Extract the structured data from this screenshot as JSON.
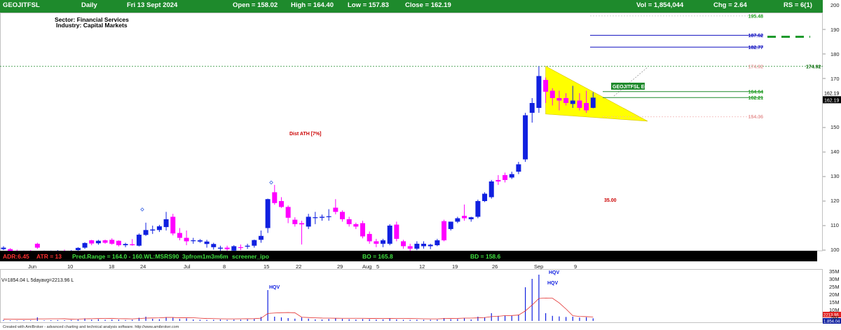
{
  "header": {
    "symbol": "GEOJITFSL",
    "interval": "Daily",
    "date": "Fri 13 Sept 2024",
    "open": "Open = 158.02",
    "high": "High = 164.40",
    "low": "Low = 157.83",
    "close": "Close = 162.19",
    "vol": "Vol = 1,854,044",
    "chg": "Chg = 2.64",
    "rs": "RS = 6(1)"
  },
  "sector": "Sector: Financial Services",
  "industry": "Industry: Capital Markets",
  "status_bar": {
    "adr": "ADR:6.45",
    "atr": "ATR = 13",
    "pred": "Pred.Range = 164.0 - 160.WL:MSRS90",
    "screens": "3pfrom1m3m6m",
    "screener": "screener_ipo",
    "bo": "BO = 165.8",
    "bd": "BD = 158.6"
  },
  "date_labels": [
    "Jun",
    "10",
    "18",
    "24",
    "Jul",
    "8",
    "15",
    "22",
    "29",
    "Aug",
    "5",
    "12",
    "19",
    "26",
    "Sep",
    "9"
  ],
  "volume_info": "V=1854.04 L 5dayavg=2213.96 L",
  "credit": "Created with AmiBroker - advanced charting and technical analysis software. http://www.amibroker.com",
  "colors": {
    "up": "#1020e0",
    "down": "#ff00ff",
    "triangle": "#ffff00",
    "header_bg": "#1e8a2c",
    "ma_line": "#e23030"
  },
  "chart_data": [
    {
      "type": "candlestick",
      "title": "GEOJITFSL",
      "y_ticks": [
        100,
        110,
        120,
        130,
        140,
        150,
        160,
        170,
        180,
        190,
        200
      ],
      "ylim": [
        97,
        204
      ],
      "grid": false,
      "candles": [
        {
          "o": 101.0,
          "h": 101.6,
          "l": 100.0,
          "c": 100.4,
          "d": "up"
        },
        {
          "o": 100.4,
          "h": 100.8,
          "l": 99.2,
          "c": 99.6,
          "d": "down"
        },
        {
          "o": 99.6,
          "h": 100.2,
          "l": 98.8,
          "c": 99.0,
          "d": "down"
        },
        {
          "o": 99.0,
          "h": 99.8,
          "l": 98.5,
          "c": 99.4,
          "d": "up"
        },
        {
          "o": 99.4,
          "h": 100.0,
          "l": 98.9,
          "c": 99.2,
          "d": "down"
        },
        {
          "o": 101.0,
          "h": 103.0,
          "l": 100.5,
          "c": 102.6,
          "d": "down"
        },
        {
          "o": 99.0,
          "h": 99.8,
          "l": 98.4,
          "c": 99.3,
          "d": "up"
        },
        {
          "o": 99.3,
          "h": 99.8,
          "l": 98.8,
          "c": 99.5,
          "d": "up"
        },
        {
          "o": 99.5,
          "h": 100.0,
          "l": 99.0,
          "c": 99.7,
          "d": "up"
        },
        {
          "o": 99.7,
          "h": 100.2,
          "l": 99.2,
          "c": 99.4,
          "d": "down"
        },
        {
          "o": 99.4,
          "h": 100.0,
          "l": 98.9,
          "c": 99.6,
          "d": "up"
        },
        {
          "o": 100.0,
          "h": 101.2,
          "l": 99.0,
          "c": 100.9,
          "d": "up"
        },
        {
          "o": 101.0,
          "h": 103.2,
          "l": 100.5,
          "c": 102.9,
          "d": "up"
        },
        {
          "o": 104.0,
          "h": 104.2,
          "l": 102.0,
          "c": 102.7,
          "d": "down"
        },
        {
          "o": 102.8,
          "h": 104.2,
          "l": 102.2,
          "c": 103.8,
          "d": "up"
        },
        {
          "o": 104.0,
          "h": 104.3,
          "l": 102.6,
          "c": 103.0,
          "d": "down"
        },
        {
          "o": 102.6,
          "h": 104.8,
          "l": 102.2,
          "c": 104.2,
          "d": "down"
        },
        {
          "o": 103.8,
          "h": 104.0,
          "l": 101.5,
          "c": 102.0,
          "d": "down"
        },
        {
          "o": 102.0,
          "h": 103.0,
          "l": 101.2,
          "c": 102.5,
          "d": "up"
        },
        {
          "o": 102.4,
          "h": 104.5,
          "l": 101.8,
          "c": 102.0,
          "d": "down"
        },
        {
          "o": 101.8,
          "h": 106.8,
          "l": 101.5,
          "c": 106.3,
          "d": "up"
        },
        {
          "o": 106.2,
          "h": 111.2,
          "l": 105.8,
          "c": 108.2,
          "d": "up"
        },
        {
          "o": 108.0,
          "h": 110.0,
          "l": 106.6,
          "c": 108.4,
          "d": "up"
        },
        {
          "o": 108.2,
          "h": 110.3,
          "l": 107.4,
          "c": 109.7,
          "d": "up"
        },
        {
          "o": 109.4,
          "h": 115.6,
          "l": 108.0,
          "c": 112.6,
          "d": "up"
        },
        {
          "o": 113.6,
          "h": 114.8,
          "l": 106.0,
          "c": 106.8,
          "d": "down"
        },
        {
          "o": 107.0,
          "h": 109.0,
          "l": 104.0,
          "c": 105.0,
          "d": "down"
        },
        {
          "o": 105.0,
          "h": 108.0,
          "l": 102.0,
          "c": 103.6,
          "d": "down"
        },
        {
          "o": 103.8,
          "h": 105.0,
          "l": 102.6,
          "c": 104.0,
          "d": "up"
        },
        {
          "o": 104.0,
          "h": 104.5,
          "l": 103.0,
          "c": 103.5,
          "d": "up"
        },
        {
          "o": 103.5,
          "h": 104.2,
          "l": 101.0,
          "c": 102.5,
          "d": "up"
        },
        {
          "o": 102.5,
          "h": 103.0,
          "l": 100.2,
          "c": 101.2,
          "d": "up"
        },
        {
          "o": 100.6,
          "h": 101.8,
          "l": 99.6,
          "c": 101.0,
          "d": "up"
        },
        {
          "o": 101.0,
          "h": 101.8,
          "l": 99.8,
          "c": 100.4,
          "d": "down"
        },
        {
          "o": 99.8,
          "h": 102.0,
          "l": 99.2,
          "c": 101.6,
          "d": "up"
        },
        {
          "o": 101.2,
          "h": 102.3,
          "l": 100.0,
          "c": 101.0,
          "d": "down"
        },
        {
          "o": 101.4,
          "h": 102.6,
          "l": 100.5,
          "c": 101.8,
          "d": "up"
        },
        {
          "o": 101.8,
          "h": 104.3,
          "l": 101.0,
          "c": 104.1,
          "d": "up"
        },
        {
          "o": 104.2,
          "h": 108.0,
          "l": 103.0,
          "c": 105.8,
          "d": "up"
        },
        {
          "o": 109.0,
          "h": 121.0,
          "l": 107.0,
          "c": 120.8,
          "d": "up"
        },
        {
          "o": 123.6,
          "h": 126.6,
          "l": 118.5,
          "c": 119.2,
          "d": "down"
        },
        {
          "o": 120.0,
          "h": 121.6,
          "l": 117.2,
          "c": 117.6,
          "d": "down"
        },
        {
          "o": 117.6,
          "h": 118.2,
          "l": 111.0,
          "c": 113.2,
          "d": "down"
        },
        {
          "o": 112.4,
          "h": 113.4,
          "l": 109.6,
          "c": 110.6,
          "d": "down"
        },
        {
          "o": 111.0,
          "h": 112.0,
          "l": 102.3,
          "c": 110.5,
          "d": "down"
        },
        {
          "o": 109.6,
          "h": 114.8,
          "l": 108.6,
          "c": 113.6,
          "d": "up"
        },
        {
          "o": 113.4,
          "h": 115.6,
          "l": 110.6,
          "c": 113.2,
          "d": "up"
        },
        {
          "o": 113.2,
          "h": 114.5,
          "l": 112.0,
          "c": 113.6,
          "d": "up"
        },
        {
          "o": 113.8,
          "h": 116.7,
          "l": 112.0,
          "c": 113.6,
          "d": "up"
        },
        {
          "o": 117.3,
          "h": 120.8,
          "l": 114.6,
          "c": 115.6,
          "d": "down"
        },
        {
          "o": 115.6,
          "h": 116.2,
          "l": 111.6,
          "c": 112.6,
          "d": "down"
        },
        {
          "o": 112.6,
          "h": 113.6,
          "l": 109.6,
          "c": 110.6,
          "d": "down"
        },
        {
          "o": 110.6,
          "h": 111.2,
          "l": 108.6,
          "c": 109.6,
          "d": "down"
        },
        {
          "o": 111.0,
          "h": 112.0,
          "l": 104.8,
          "c": 105.6,
          "d": "down"
        },
        {
          "o": 106.6,
          "h": 107.6,
          "l": 102.6,
          "c": 103.6,
          "d": "down"
        },
        {
          "o": 103.6,
          "h": 104.6,
          "l": 101.2,
          "c": 102.6,
          "d": "down"
        },
        {
          "o": 102.6,
          "h": 104.6,
          "l": 101.2,
          "c": 104.0,
          "d": "up"
        },
        {
          "o": 102.6,
          "h": 110.6,
          "l": 102.0,
          "c": 110.0,
          "d": "up"
        },
        {
          "o": 110.4,
          "h": 111.6,
          "l": 103.6,
          "c": 104.6,
          "d": "down"
        },
        {
          "o": 103.6,
          "h": 104.2,
          "l": 100.6,
          "c": 101.6,
          "d": "down"
        },
        {
          "o": 101.6,
          "h": 102.6,
          "l": 99.6,
          "c": 100.6,
          "d": "down"
        },
        {
          "o": 100.6,
          "h": 103.6,
          "l": 100.0,
          "c": 102.6,
          "d": "up"
        },
        {
          "o": 102.6,
          "h": 103.6,
          "l": 100.6,
          "c": 101.6,
          "d": "up"
        },
        {
          "o": 101.6,
          "h": 102.6,
          "l": 100.4,
          "c": 102.2,
          "d": "up"
        },
        {
          "o": 102.0,
          "h": 104.6,
          "l": 101.6,
          "c": 104.0,
          "d": "up"
        },
        {
          "o": 104.0,
          "h": 112.4,
          "l": 103.6,
          "c": 111.8,
          "d": "down"
        },
        {
          "o": 108.6,
          "h": 111.6,
          "l": 108.0,
          "c": 111.6,
          "d": "up"
        },
        {
          "o": 111.6,
          "h": 113.6,
          "l": 111.0,
          "c": 113.0,
          "d": "up"
        },
        {
          "o": 113.0,
          "h": 118.6,
          "l": 112.0,
          "c": 114.0,
          "d": "down"
        },
        {
          "o": 112.6,
          "h": 113.6,
          "l": 111.6,
          "c": 113.4,
          "d": "up"
        },
        {
          "o": 113.6,
          "h": 120.6,
          "l": 113.0,
          "c": 120.0,
          "d": "up"
        },
        {
          "o": 120.0,
          "h": 123.6,
          "l": 119.6,
          "c": 123.0,
          "d": "up"
        },
        {
          "o": 121.6,
          "h": 128.6,
          "l": 121.0,
          "c": 128.0,
          "d": "up"
        },
        {
          "o": 128.0,
          "h": 130.6,
          "l": 126.6,
          "c": 128.6,
          "d": "down"
        },
        {
          "o": 128.6,
          "h": 131.6,
          "l": 127.6,
          "c": 130.6,
          "d": "down"
        },
        {
          "o": 129.6,
          "h": 132.0,
          "l": 129.0,
          "c": 131.0,
          "d": "up"
        },
        {
          "o": 132.0,
          "h": 136.0,
          "l": 131.0,
          "c": 135.0,
          "d": "up"
        },
        {
          "o": 137.0,
          "h": 156.0,
          "l": 136.0,
          "c": 155.0,
          "d": "up"
        },
        {
          "o": 156.0,
          "h": 162.0,
          "l": 152.0,
          "c": 160.0,
          "d": "up"
        },
        {
          "o": 158.0,
          "h": 175.0,
          "l": 156.0,
          "c": 171.0,
          "d": "up"
        },
        {
          "o": 169.4,
          "h": 170.4,
          "l": 160.0,
          "c": 164.6,
          "d": "down"
        },
        {
          "o": 165.0,
          "h": 166.0,
          "l": 159.0,
          "c": 162.0,
          "d": "down"
        },
        {
          "o": 161.0,
          "h": 165.0,
          "l": 157.0,
          "c": 162.0,
          "d": "down"
        },
        {
          "o": 162.0,
          "h": 164.0,
          "l": 159.0,
          "c": 160.0,
          "d": "down"
        },
        {
          "o": 159.6,
          "h": 167.0,
          "l": 158.0,
          "c": 161.0,
          "d": "up"
        },
        {
          "o": 161.0,
          "h": 164.0,
          "l": 157.0,
          "c": 158.0,
          "d": "down"
        },
        {
          "o": 160.0,
          "h": 165.0,
          "l": 156.0,
          "c": 157.0,
          "d": "down"
        },
        {
          "o": 158.02,
          "h": 164.4,
          "l": 157.83,
          "c": 162.19,
          "d": "up"
        }
      ],
      "value_labels": [
        {
          "text": "195.48",
          "value": 195.48,
          "color": "#20a020"
        },
        {
          "text": "187.62",
          "value": 187.62,
          "color": "#1010c0"
        },
        {
          "text": "182.77",
          "value": 182.77,
          "color": "#1010c0"
        },
        {
          "text": "174.92",
          "value": 174.92,
          "color": "#e8a0a0"
        },
        {
          "text": "164.64",
          "value": 164.64,
          "color": "#20a020"
        },
        {
          "text": "162.21",
          "value": 162.21,
          "color": "#20a020"
        },
        {
          "text": "154.36",
          "value": 154.36,
          "color": "#e8a0a0"
        }
      ],
      "right_axis_labels": [
        {
          "text": "174.92",
          "value": 174.92,
          "color": "#006600"
        },
        {
          "text": "162.19",
          "value": 162.19,
          "color": "#000000"
        }
      ],
      "annotations": [
        {
          "text": "Dist ATH [7%]",
          "color": "#cc0000"
        },
        {
          "text": "35.00",
          "color": "#cc0000"
        },
        {
          "text": "GEOJITFSL EQ",
          "color": "#ffffff",
          "bg": "#1e8a2c"
        }
      ],
      "triangle_pattern": {
        "top": 175.0,
        "bottom_left": 155.5,
        "apex": 152.6
      }
    },
    {
      "type": "bar",
      "title": "Volume",
      "y_ticks": [
        "35M",
        "30M",
        "25M",
        "20M",
        "15M",
        "10M",
        "5M"
      ],
      "ylim": [
        0,
        36
      ],
      "labels": [
        "HQV",
        "HQV",
        "HQV"
      ],
      "current_value": "1.854.04",
      "ma_value": "2213.96",
      "values_lakh": [
        0.6,
        0.4,
        0.3,
        0.5,
        0.4,
        2.5,
        0.4,
        0.5,
        0.6,
        0.5,
        0.6,
        0.9,
        1.8,
        0.9,
        1.2,
        0.8,
        1.0,
        0.9,
        0.6,
        0.8,
        2.2,
        3.0,
        1.5,
        1.2,
        2.6,
        2.2,
        1.4,
        1.8,
        1.0,
        0.8,
        0.7,
        0.8,
        1.0,
        0.7,
        0.9,
        0.9,
        1.1,
        1.3,
        2.8,
        22.0,
        3.0,
        2.5,
        2.0,
        1.6,
        2.4,
        1.6,
        1.1,
        1.0,
        1.4,
        1.8,
        1.4,
        1.2,
        1.0,
        1.3,
        1.2,
        1.0,
        1.1,
        1.6,
        1.1,
        0.8,
        0.7,
        0.9,
        0.8,
        0.8,
        0.9,
        2.0,
        1.2,
        1.3,
        2.0,
        1.0,
        3.0,
        2.6,
        5.5,
        3.6,
        3.8,
        3.6,
        4.5,
        24.0,
        30.0,
        33.0,
        5.5,
        3.6,
        3.2,
        2.8,
        3.0,
        2.4,
        2.6,
        1.85
      ]
    }
  ]
}
